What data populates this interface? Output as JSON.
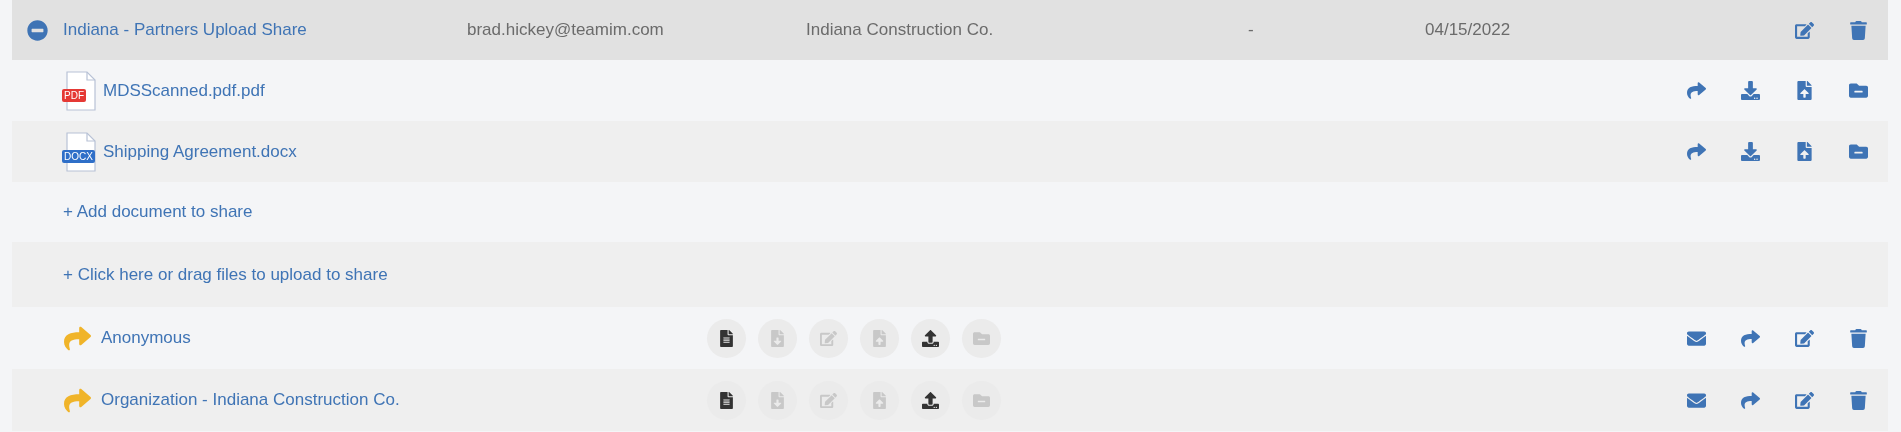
{
  "share": {
    "expanded": true,
    "name": "Indiana - Partners Upload Share",
    "owner": "brad.hickey@teamim.com",
    "company": "Indiana Construction Co.",
    "column_4": "-",
    "date": "04/15/2022"
  },
  "documents": [
    {
      "type_label": "PDF",
      "color": "#e53935",
      "name": "MDSScanned.pdf.pdf"
    },
    {
      "type_label": "DOCX",
      "color": "#2f6fc8",
      "name": "Shipping Agreement.docx"
    }
  ],
  "add_links": [
    "+ Add document to share",
    "+ Click here or drag files to upload to share"
  ],
  "recipients": [
    {
      "name": "Anonymous",
      "permissions": [
        {
          "kind": "view",
          "on": true
        },
        {
          "kind": "download",
          "on": false
        },
        {
          "kind": "edit",
          "on": false
        },
        {
          "kind": "replace",
          "on": false
        },
        {
          "kind": "upload",
          "on": true
        },
        {
          "kind": "remove",
          "on": false
        }
      ]
    },
    {
      "name": "Organization - Indiana Construction Co.",
      "permissions": [
        {
          "kind": "view",
          "on": true
        },
        {
          "kind": "download",
          "on": false
        },
        {
          "kind": "edit",
          "on": false
        },
        {
          "kind": "replace",
          "on": false
        },
        {
          "kind": "upload",
          "on": true
        },
        {
          "kind": "remove",
          "on": false
        }
      ]
    }
  ]
}
